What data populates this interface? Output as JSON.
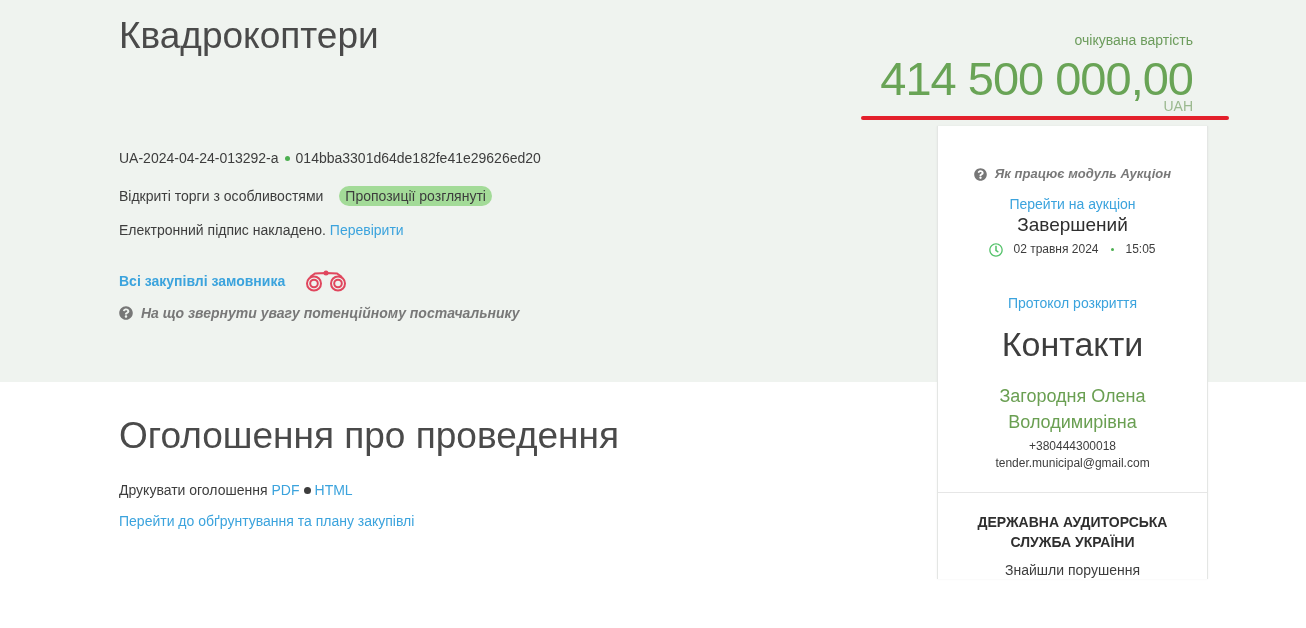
{
  "header": {
    "title": "Квадрокоптери",
    "price_label": "очікувана вартість",
    "price": "414 500 000,00",
    "currency": "UAH"
  },
  "tender": {
    "id": "UA-2024-04-24-013292-a",
    "hash": "014bba3301d64de182fe41e29626ed20",
    "procedure": "Відкриті торги з особливостями",
    "status": "Пропозиції розглянуті",
    "signature_text": "Електронний підпис накладено.",
    "signature_link": "Перевірити",
    "buyer_link": "Всі закупівлі замовника",
    "hint": "На що звернути увагу потенційному постачальнику"
  },
  "announcement": {
    "heading": "Оголошення про проведення",
    "print_label": "Друкувати оголошення",
    "formats": [
      "PDF",
      "HTML"
    ],
    "plan_link": "Перейти до обґрунтування та плану закупівлі"
  },
  "sidebar": {
    "auction_help": "Як працює модуль Аукціон",
    "auction_link": "Перейти на аукціон",
    "auction_status": "Завершений",
    "auction_date": "02 травня 2024",
    "auction_time": "15:05",
    "protocol_link": "Протокол розкриття",
    "contacts_heading": "Контакти",
    "contact_name": "Загородня Олена Володимирівна",
    "phone": "+380444300018",
    "email": "tender.municipal@gmail.com",
    "audit_title": "ДЕРЖАВНА АУДИТОРСЬКА СЛУЖБА УКРАЇНИ",
    "audit_text": "Знайшли порушення"
  }
}
